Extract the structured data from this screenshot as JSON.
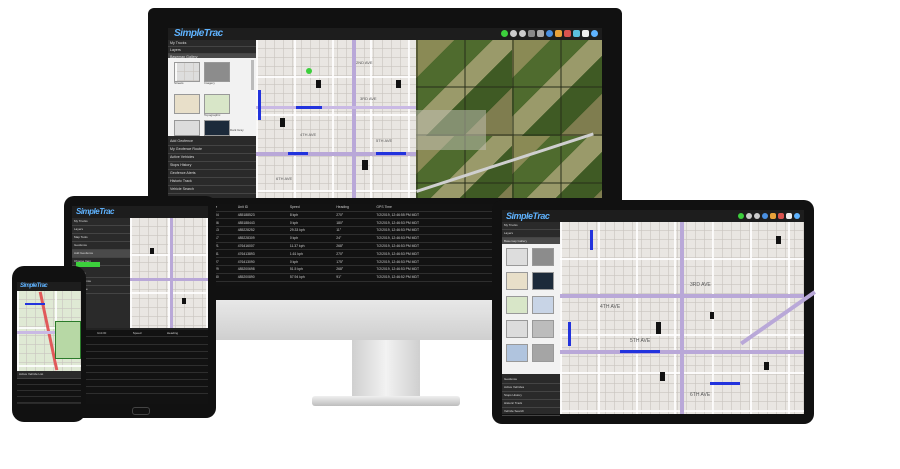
{
  "app": {
    "logo": "SimpleTrac"
  },
  "colors": {
    "accent": "#5fb3ff",
    "track": "#2233dd",
    "highlight": "#3ccf3c"
  },
  "toolbar_icons": [
    "check-icon",
    "zoom-in-icon",
    "zoom-out-icon",
    "globe-icon",
    "grid-icon",
    "print-icon",
    "chart-icon",
    "layers-icon",
    "bookmark-icon",
    "menu-icon",
    "settings-icon"
  ],
  "desktop": {
    "sidebar": [
      "My Trucks",
      "Layers",
      "Basemap Gallery",
      "Streets",
      "Imagery",
      "Topographic",
      "Dark Gray",
      "Add Geofence",
      "My Geofence Route",
      "Active Vehicles",
      "Stops History",
      "Geofence Alerts",
      "Historic Track",
      "Vehicle Search"
    ],
    "grid_headers": [
      "Title",
      "Unit ID",
      "Speed",
      "Heading",
      "GPS Time",
      "Number 1",
      "Number 2"
    ],
    "grid_rows": [
      [
        "T204",
        "485188523",
        "8 kph",
        "270°",
        "7/2/2019, 12:46:55 PM MDT",
        "Ign ON",
        "Plow UP"
      ],
      [
        "T206",
        "485188443",
        "0 kph",
        "180°",
        "7/2/2019, 12:46:53 PM MDT",
        "Ign ON",
        "Plow DOWN"
      ],
      [
        "T213",
        "485228252",
        "29.33 kph",
        "11°",
        "7/2/2019, 12:46:53 PM MDT",
        "Ign ON",
        ""
      ],
      [
        "T217",
        "485228309",
        "0 kph",
        "24°",
        "7/2/2019, 12:46:53 PM MDT",
        "Ign ON",
        ""
      ],
      [
        "T221",
        "476416007",
        "11.37 kph",
        "268°",
        "7/2/2019, 12:46:53 PM MDT",
        "Ign ON",
        "Arm UP"
      ],
      [
        "T231",
        "476413893",
        "1.61 kph",
        "270°",
        "7/2/2019, 12:46:53 PM MDT",
        "Ign ON",
        "Plow DOWN"
      ],
      [
        "T227",
        "476413090",
        "0 kph",
        "175°",
        "7/2/2019, 12:46:53 PM MDT",
        "Ign ON",
        ""
      ],
      [
        "T229",
        "485200698",
        "51.5 kph",
        "268°",
        "7/2/2019, 12:46:53 PM MDT",
        "Ign ON",
        ""
      ],
      [
        "T230",
        "485200890",
        "57.94 kph",
        "91°",
        "7/2/2019, 12:46:52 PM MDT",
        "Ign ON",
        ""
      ]
    ],
    "street_labels": [
      "2ND AVE",
      "3RD AVE",
      "4TH AVE",
      "5TH AVE",
      "6TH AVE"
    ]
  },
  "tablet_left": {
    "sidebar": [
      "My Trucks",
      "Layers",
      "Map Tools",
      "Geofence",
      "Add Geofence",
      "Choose Item",
      "Stops",
      "Geofence",
      "Vehicle"
    ],
    "grid_headers": [
      "Title",
      "Unit ID",
      "Speed",
      "Heading"
    ]
  },
  "tablet_right": {
    "sidebar": [
      "My Trucks",
      "Layers",
      "Basemap Gallery",
      "Geofence",
      "Active Vehicles",
      "Stops History",
      "Historic Track",
      "Vehicle Search"
    ]
  },
  "phone": {
    "bottom_label": "Active Vehicle List"
  }
}
